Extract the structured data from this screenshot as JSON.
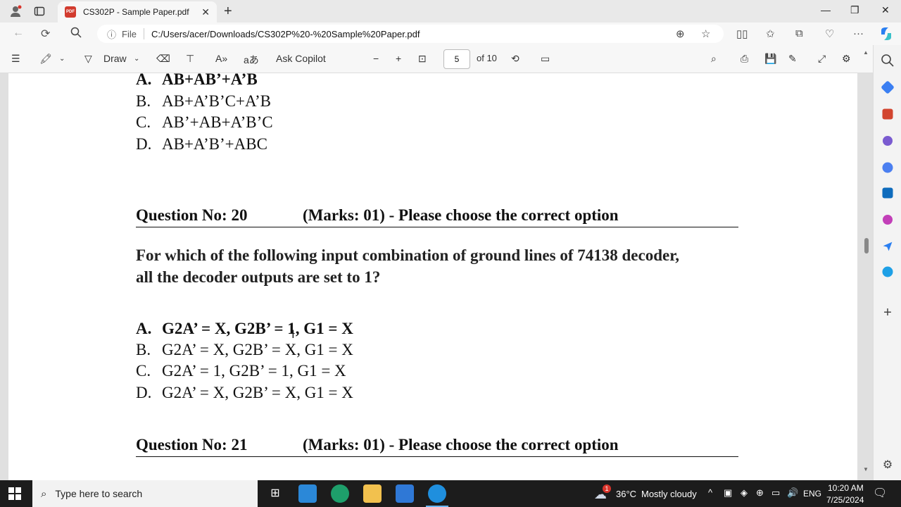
{
  "browser": {
    "tab_title": "CS302P - Sample Paper.pdf",
    "url_label": "File",
    "url": "C:/Users/acer/Downloads/CS302P%20-%20Sample%20Paper.pdf"
  },
  "pdf_toolbar": {
    "draw_label": "Draw",
    "ask_copilot_label": "Ask Copilot",
    "current_page": "5",
    "page_total": "of 10"
  },
  "document": {
    "prev_options": [
      {
        "letter": "A.",
        "text": "AB+AB’+A’B",
        "selected": true
      },
      {
        "letter": "B.",
        "text": "AB+A’B’C+A’B",
        "selected": false
      },
      {
        "letter": "C.",
        "text": "AB’+AB+A’B’C",
        "selected": false
      },
      {
        "letter": "D.",
        "text": "AB+A’B’+ABC",
        "selected": false
      }
    ],
    "q20": {
      "number": "Question No: 20",
      "marks": "(Marks: 01) - Please choose the correct option",
      "text_line1": "For which of the following input combination of ground lines of 74138 decoder,",
      "text_line2": "all the decoder outputs are set to 1?",
      "options": [
        {
          "letter": "A.",
          "text": "G2A’ = X, G2B’ = 1, G1 = X",
          "selected": true
        },
        {
          "letter": "B.",
          "text": "G2A’ = X, G2B’ = X, G1 = X",
          "selected": false
        },
        {
          "letter": "C.",
          "text": "G2A’ = 1, G2B’ = 1, G1 = X",
          "selected": false
        },
        {
          "letter": "D.",
          "text": "G2A’ = X, G2B’ = X, G1 = X",
          "selected": false
        }
      ]
    },
    "q21": {
      "number": "Question No: 21",
      "marks": "(Marks: 01) - Please choose the correct option"
    }
  },
  "taskbar": {
    "search_placeholder": "Type here to search",
    "weather_temp": "36°C",
    "weather_desc": "Mostly cloudy",
    "weather_badge": "1",
    "language": "ENG",
    "time": "10:20 AM",
    "date": "7/25/2024"
  },
  "colors": {
    "accent": "#0078d4",
    "pdf_red": "#d23b2e",
    "taskbar": "#1c1c1c"
  }
}
